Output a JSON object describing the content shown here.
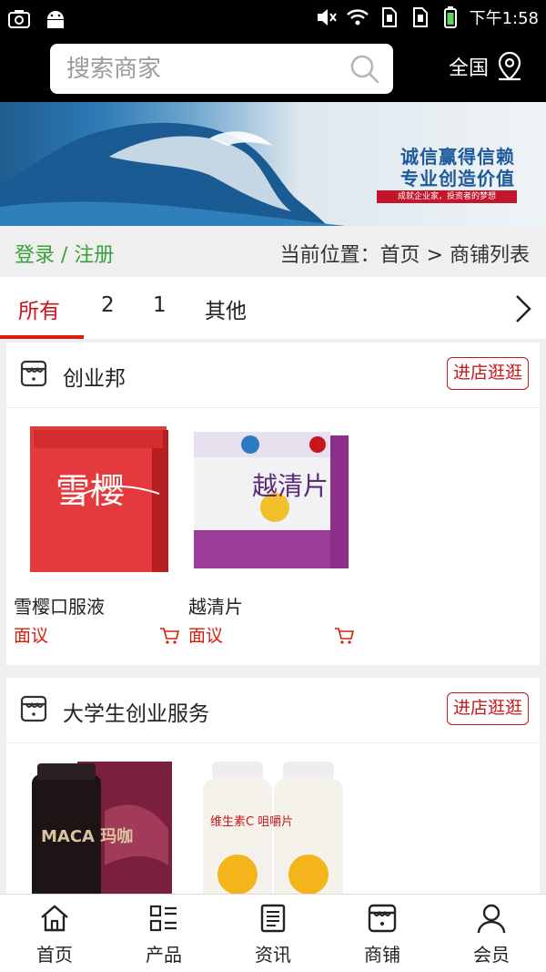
{
  "status_bar": {
    "time": "下午1:58",
    "icons": [
      "camera-icon",
      "android-icon",
      "mute-icon",
      "wifi-icon",
      "sim1-icon",
      "sim2-icon",
      "battery-icon"
    ]
  },
  "header": {
    "search_placeholder": "搜索商家",
    "region_label": "全国"
  },
  "banner": {
    "headline1": "诚信赢得信赖",
    "headline2": "专业创造价值",
    "tagline": "成就企业家，投资者的梦想"
  },
  "infobar": {
    "login_label": "登录 / 注册",
    "breadcrumb": "当前位置：首页 > 商铺列表"
  },
  "tabs": [
    {
      "label": "所有",
      "active": true
    },
    {
      "label": "2",
      "active": false
    },
    {
      "label": "1",
      "active": false
    },
    {
      "label": "其他",
      "active": false
    }
  ],
  "shops": [
    {
      "name": "创业邦",
      "enter_label": "进店逛逛",
      "products": [
        {
          "name": "雪樱口服液",
          "price": "面议",
          "image_text": "雪樱"
        },
        {
          "name": "越清片",
          "price": "面议",
          "image_text": "越清片"
        }
      ]
    },
    {
      "name": "大学生创业服务",
      "enter_label": "进店逛逛",
      "products": [
        {
          "name": "",
          "price": "",
          "image_text": "MACA 玛咖"
        },
        {
          "name": "",
          "price": "",
          "image_text": "维生素C 咀嚼片"
        }
      ]
    }
  ],
  "bottom_nav": [
    {
      "label": "首页",
      "icon": "home-icon"
    },
    {
      "label": "产品",
      "icon": "grid-list-icon"
    },
    {
      "label": "资讯",
      "icon": "news-icon"
    },
    {
      "label": "商铺",
      "icon": "store-icon"
    },
    {
      "label": "会员",
      "icon": "user-icon"
    }
  ],
  "colors": {
    "accent_red": "#d81e06",
    "login_green": "#3aa13a",
    "header_bg": "#000000"
  }
}
